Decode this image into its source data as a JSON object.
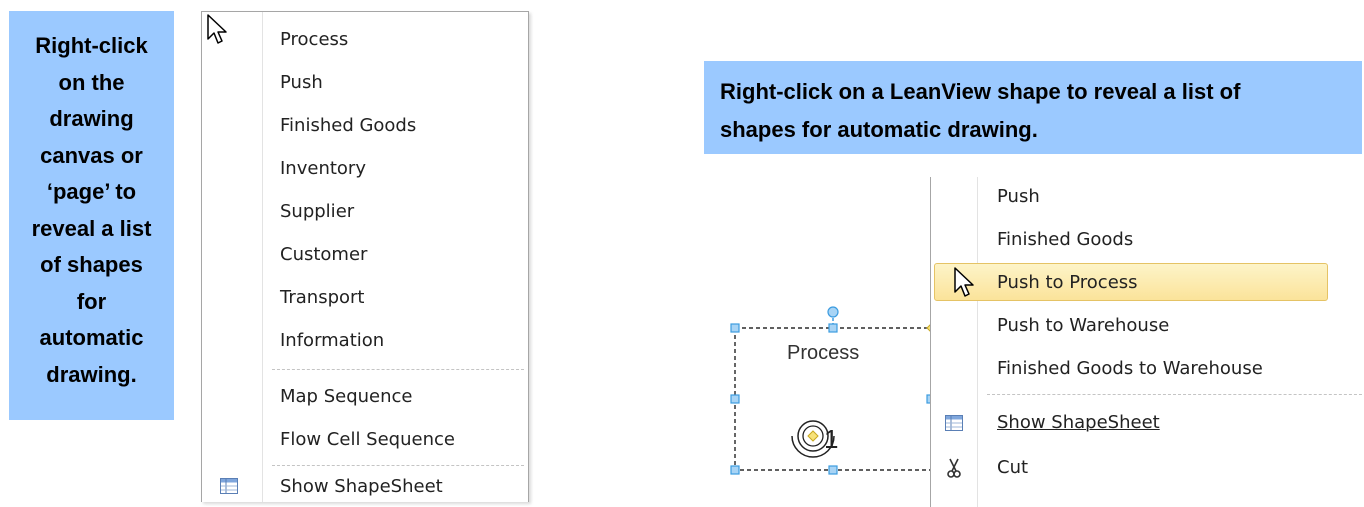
{
  "left_callout": {
    "lines": [
      "Right-click",
      "on the",
      "drawing",
      "canvas or",
      "‘page’ to",
      "reveal a list",
      "of shapes",
      "for",
      "automatic",
      "drawing."
    ]
  },
  "right_callout": {
    "lines": [
      "Right-click on a LeanView shape to reveal a list of",
      "shapes for automatic drawing."
    ]
  },
  "left_menu": {
    "items": [
      "Process",
      "Push",
      "Finished Goods",
      "Inventory",
      "Supplier",
      "Customer",
      "Transport",
      "Information"
    ],
    "sequence_items": [
      "Map Sequence",
      "Flow Cell Sequence"
    ],
    "shapesheet_label": "Show ShapeSheet",
    "shapesheet_icon": "table-icon",
    "cursor_icon": "arrow-cursor-icon"
  },
  "right_menu": {
    "items": [
      "Push",
      "Finished Goods"
    ],
    "highlighted_item": "Push to Process",
    "more_items": [
      "Push to Warehouse",
      "Finished Goods to Warehouse"
    ],
    "shapesheet_label": "Show ShapeSheet",
    "shapesheet_icon": "table-icon",
    "cut_label": "Cut",
    "cut_icon": "scissors-icon",
    "cursor_icon": "arrow-cursor-icon"
  },
  "shape": {
    "label": "Process",
    "number": "1"
  },
  "colors": {
    "callout_background": "#9bc9ff",
    "menu_highlight": "#fbe39a",
    "handle_blue": "#3c9ce0"
  }
}
